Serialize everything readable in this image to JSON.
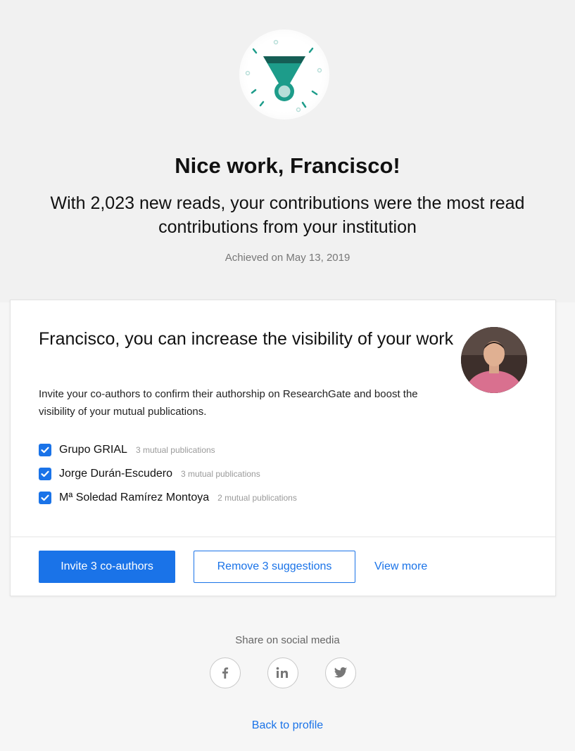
{
  "achievement": {
    "headline": "Nice work, Francisco!",
    "subheadline": "With 2,023 new reads, your contributions were the most read contributions from your institution",
    "achieved_date": "Achieved on May 13, 2019"
  },
  "card": {
    "title": "Francisco, you can increase the visibility of your work",
    "description": "Invite your co-authors to confirm their authorship on ResearchGate and boost the visibility of your mutual publications.",
    "coauthors": [
      {
        "name": "Grupo GRIAL",
        "meta": "3 mutual publications",
        "checked": true
      },
      {
        "name": "Jorge Durán-Escudero",
        "meta": "3 mutual publications",
        "checked": true
      },
      {
        "name": "Mª Soledad Ramírez Montoya",
        "meta": "2 mutual publications",
        "checked": true
      }
    ],
    "invite_label": "Invite 3 co-authors",
    "remove_label": "Remove 3 suggestions",
    "view_more_label": "View more"
  },
  "share": {
    "label": "Share on social media",
    "icons": [
      "facebook-icon",
      "linkedin-icon",
      "twitter-icon"
    ]
  },
  "back_label": "Back to profile",
  "colors": {
    "accent": "#1a73e8",
    "badge_teal": "#1d9c8a",
    "badge_dark": "#155e55"
  }
}
